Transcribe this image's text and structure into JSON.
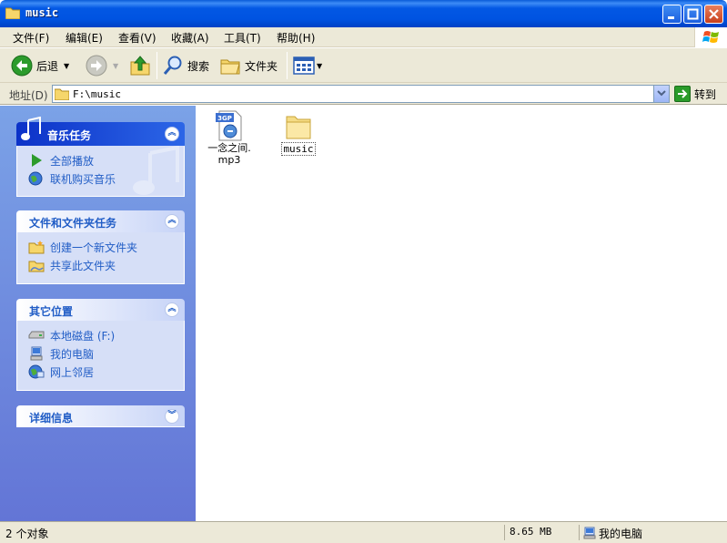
{
  "window": {
    "title": "music"
  },
  "menu": [
    "文件(F)",
    "编辑(E)",
    "查看(V)",
    "收藏(A)",
    "工具(T)",
    "帮助(H)"
  ],
  "toolbar": {
    "back": "后退",
    "search": "搜索",
    "folders": "文件夹"
  },
  "address": {
    "label": "地址(D)",
    "path": "F:\\music",
    "go": "转到"
  },
  "panels": {
    "music_tasks": {
      "title": "音乐任务",
      "items": [
        "全部播放",
        "联机购买音乐"
      ]
    },
    "file_tasks": {
      "title": "文件和文件夹任务",
      "items": [
        "创建一个新文件夹",
        "共享此文件夹"
      ]
    },
    "other_places": {
      "title": "其它位置",
      "items": [
        "本地磁盘 (F:)",
        "我的电脑",
        "网上邻居"
      ]
    },
    "details": {
      "title": "详细信息"
    }
  },
  "files": [
    {
      "name_line1": "一念之间.",
      "name_line2": "mp3",
      "type": "3gp-media",
      "badge": "3GP"
    },
    {
      "name": "music",
      "type": "folder"
    }
  ],
  "status": {
    "count": "2 个对象",
    "size": "8.65 MB",
    "location": "我的电脑"
  },
  "colors": {
    "titlebar": "#0053e1",
    "taskpane": "#6375d6",
    "link": "#215dc6"
  }
}
